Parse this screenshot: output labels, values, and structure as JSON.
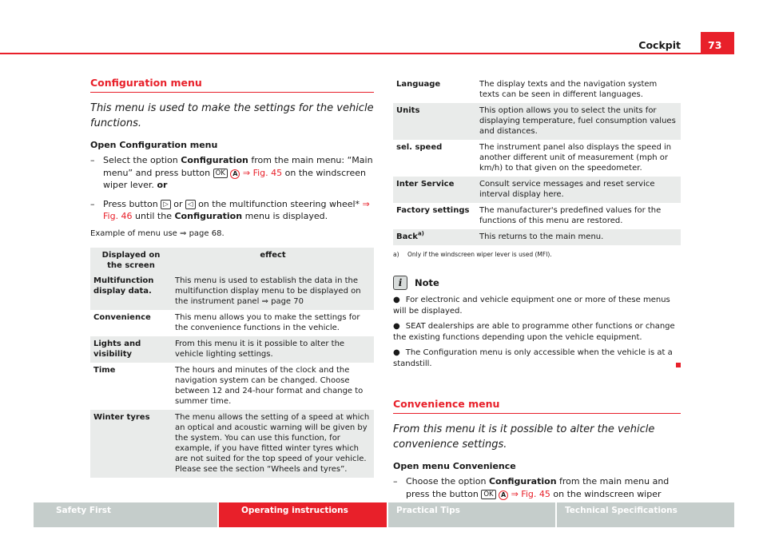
{
  "header": {
    "section": "Cockpit",
    "page_number": "73"
  },
  "colors": {
    "accent": "#e8202a",
    "tab_inactive": "#c5cdcb",
    "row_shade": "#e9ebea"
  },
  "config_menu": {
    "title": "Configuration menu",
    "intro": "This menu is used to make the settings for the vehicle functions.",
    "open_heading": "Open Configuration menu",
    "step1": {
      "dash": "–",
      "t1": "Select the option ",
      "b1": "Configuration",
      "t2": " from the main menu: “Main menu” and press button ",
      "key_ok": "OK",
      "key_a": "A",
      "link": "⇒ Fig. 45",
      "t3": " on the windscreen wiper lever. ",
      "b2": "or"
    },
    "step2": {
      "dash": "–",
      "t1": "Press button ",
      "key_next": "▷",
      "t2": " or ",
      "key_prev": "◁",
      "t3": " on the multifunction steering wheel* ",
      "link": "⇒ Fig. 46",
      "t4": " until the ",
      "b1": "Configuration",
      "t5": " menu is displayed."
    },
    "example": "Example of menu use ⇒ page 68."
  },
  "left_table": {
    "headers": [
      "Displayed on the screen",
      "effect"
    ],
    "rows": [
      {
        "option": "Multifunction display data.",
        "effect": "This menu is used to establish the data in the multifunction display menu to be displayed on the instrument panel ⇒ page 70"
      },
      {
        "option": "Convenience",
        "effect": "This menu allows you to make the settings for the convenience functions in the vehicle."
      },
      {
        "option": "Lights and visibility",
        "effect": "From this menu it is it possible to alter the vehicle lighting settings."
      },
      {
        "option": "Time",
        "effect": "The hours and minutes of the clock and the navigation system can be changed. Choose between 12 and 24-hour format and change to summer time."
      },
      {
        "option": "Winter tyres",
        "effect": "The menu allows the setting of a speed at which an optical and acoustic warning will be given by the system. You can use this function, for example, if you have fitted winter tyres which are not suited for the top speed of your vehicle. Please see the section “Wheels and tyres”."
      }
    ]
  },
  "right_table": {
    "rows": [
      {
        "option": "Language",
        "effect": "The display texts and the navigation system texts can be seen in different languages."
      },
      {
        "option": "Units",
        "effect": "This option allows you to select the units for displaying temperature, fuel consumption values and distances."
      },
      {
        "option": "sel. speed",
        "effect": "The instrument panel also displays the speed in another different unit of measurement (mph or km/h) to that given on the speedometer."
      },
      {
        "option": "Inter Service",
        "effect": "Consult service messages and reset service interval display here."
      },
      {
        "option": "Factory settings",
        "effect": "The manufacturer's predefined values for the functions of this menu are restored."
      },
      {
        "option": "Back",
        "sup": "a)",
        "effect": "This returns to the main menu."
      }
    ],
    "footnote_mark": "a)",
    "footnote": "Only if the windscreen wiper lever is used (MFI)."
  },
  "note": {
    "icon": "info-icon",
    "title": "Note",
    "bullet": "●",
    "items": [
      "For electronic and vehicle equipment one or more of these menus will be displayed.",
      "SEAT dealerships are able to programme other functions or change the existing functions depending upon the vehicle equipment.",
      "The Configuration menu is only accessible when the vehicle is at a standstill."
    ]
  },
  "convenience_menu": {
    "title": "Convenience menu",
    "intro": "From this menu it is it possible to alter the vehicle convenience settings.",
    "open_heading": "Open menu Convenience",
    "step1": {
      "dash": "–",
      "t1": "Choose the option ",
      "b1": "Configuration",
      "t2": " from the main menu and press the button ",
      "key_ok": "OK",
      "key_a": "A",
      "link": "⇒ Fig. 45",
      "t3": " on the windscreen wiper lever."
    },
    "continue_mark": "▶"
  },
  "footer": {
    "tabs": [
      {
        "label": "Safety First",
        "active": false
      },
      {
        "label": "Operating instructions",
        "active": true
      },
      {
        "label": "Practical Tips",
        "active": false
      },
      {
        "label": "Technical Specifications",
        "active": false
      }
    ]
  }
}
